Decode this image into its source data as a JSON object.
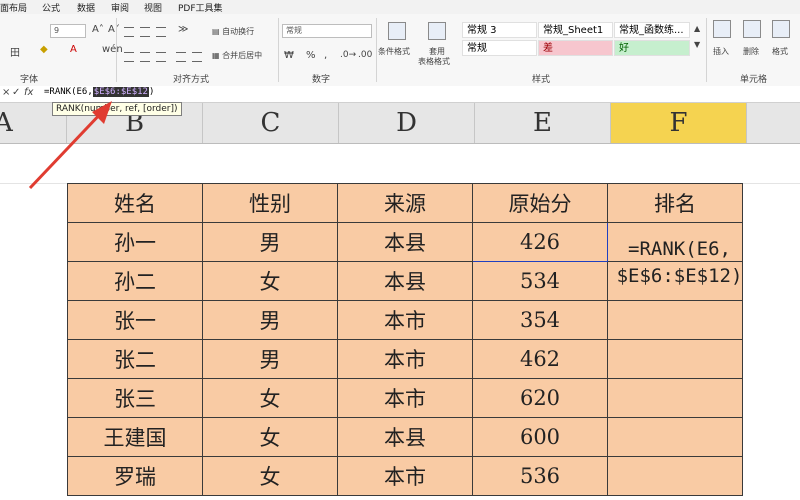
{
  "ribbon": {
    "tabs": [
      "面布局",
      "公式",
      "数据",
      "审阅",
      "视图",
      "PDF工具集"
    ],
    "font_size": "9",
    "wrap_text": "自动换行",
    "merge_center": "合并后居中",
    "number_format": "常规",
    "percent": "%",
    "comma": ",",
    "cond_format": "条件格式",
    "table_format": [
      "套用",
      "表格格式"
    ],
    "styles": [
      [
        "常规 3",
        "常规_Sheet1",
        "常规_函数练..."
      ],
      [
        "常规",
        "差",
        "好"
      ]
    ],
    "insert": "插入",
    "delete": "删除",
    "format": "格式",
    "groups": [
      "字体",
      "对齐方式",
      "数字",
      "样式",
      "单元格"
    ]
  },
  "formula_bar": {
    "icons": [
      "×",
      "✓",
      "fx"
    ],
    "prefix": "=RANK(E6,",
    "highlight": "$E$6:$E$12",
    "suffix": ")",
    "tooltip": "RANK(number, ref, [order])"
  },
  "columns": [
    "A",
    "B",
    "C",
    "D",
    "E",
    "F"
  ],
  "table": {
    "headers": [
      "姓名",
      "性别",
      "来源",
      "原始分",
      "排名"
    ],
    "rows": [
      [
        "孙一",
        "男",
        "本县",
        "426",
        ""
      ],
      [
        "孙二",
        "女",
        "本县",
        "534",
        ""
      ],
      [
        "张一",
        "男",
        "本市",
        "354",
        ""
      ],
      [
        "张二",
        "男",
        "本市",
        "462",
        ""
      ],
      [
        "张三",
        "女",
        "本市",
        "620",
        ""
      ],
      [
        "王建国",
        "女",
        "本县",
        "600",
        ""
      ],
      [
        "罗瑞",
        "女",
        "本市",
        "536",
        ""
      ]
    ],
    "rank_formula": [
      "=RANK(E6,",
      "$E$6:$E$12)"
    ]
  },
  "colors": {
    "cell_fill": "#f9cba4",
    "selected_col": "#f5d350",
    "arrow": "#e03c31"
  }
}
